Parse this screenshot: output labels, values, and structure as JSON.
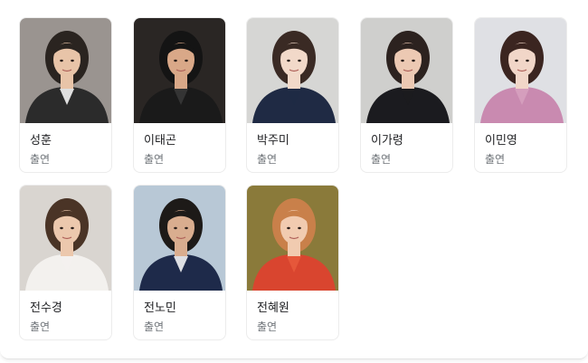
{
  "cast": [
    {
      "name": "성훈",
      "role": "출연",
      "photo": {
        "bg": "#9a9490",
        "top": "#2b2b2b",
        "skin": "#e8c4a8",
        "hair": "#2a2420",
        "accent": "#ffffff"
      }
    },
    {
      "name": "이태곤",
      "role": "출연",
      "photo": {
        "bg": "#2a2624",
        "top": "#1a1a1a",
        "skin": "#d9a888",
        "hair": "#141414",
        "accent": "#3a3a3a"
      }
    },
    {
      "name": "박주미",
      "role": "출연",
      "photo": {
        "bg": "#d6d6d4",
        "top": "#1f2a44",
        "skin": "#f2d9c9",
        "hair": "#3a2a24",
        "accent": "#1f2a44"
      }
    },
    {
      "name": "이가령",
      "role": "출연",
      "photo": {
        "bg": "#cfcfcd",
        "top": "#1b1b1f",
        "skin": "#ecc9b3",
        "hair": "#2c221f",
        "accent": "#1b1b1f"
      }
    },
    {
      "name": "이민영",
      "role": "출연",
      "photo": {
        "bg": "#dfe0e4",
        "top": "#c98ab0",
        "skin": "#f1d6c8",
        "hair": "#3b2520",
        "accent": "#d7a1c0"
      }
    },
    {
      "name": "전수경",
      "role": "출연",
      "photo": {
        "bg": "#d9d5d0",
        "top": "#f3f1ee",
        "skin": "#ecc8ad",
        "hair": "#4a3426",
        "accent": "#f3f1ee"
      }
    },
    {
      "name": "전노민",
      "role": "출연",
      "photo": {
        "bg": "#b8c8d6",
        "top": "#1e2a4a",
        "skin": "#d9ad8f",
        "hair": "#1d1a18",
        "accent": "#ffffff"
      }
    },
    {
      "name": "전혜원",
      "role": "출연",
      "photo": {
        "bg": "#8a7a3a",
        "top": "#d9452f",
        "skin": "#f1cbb0",
        "hair": "#c9804a",
        "accent": "#e85a3c"
      }
    }
  ]
}
